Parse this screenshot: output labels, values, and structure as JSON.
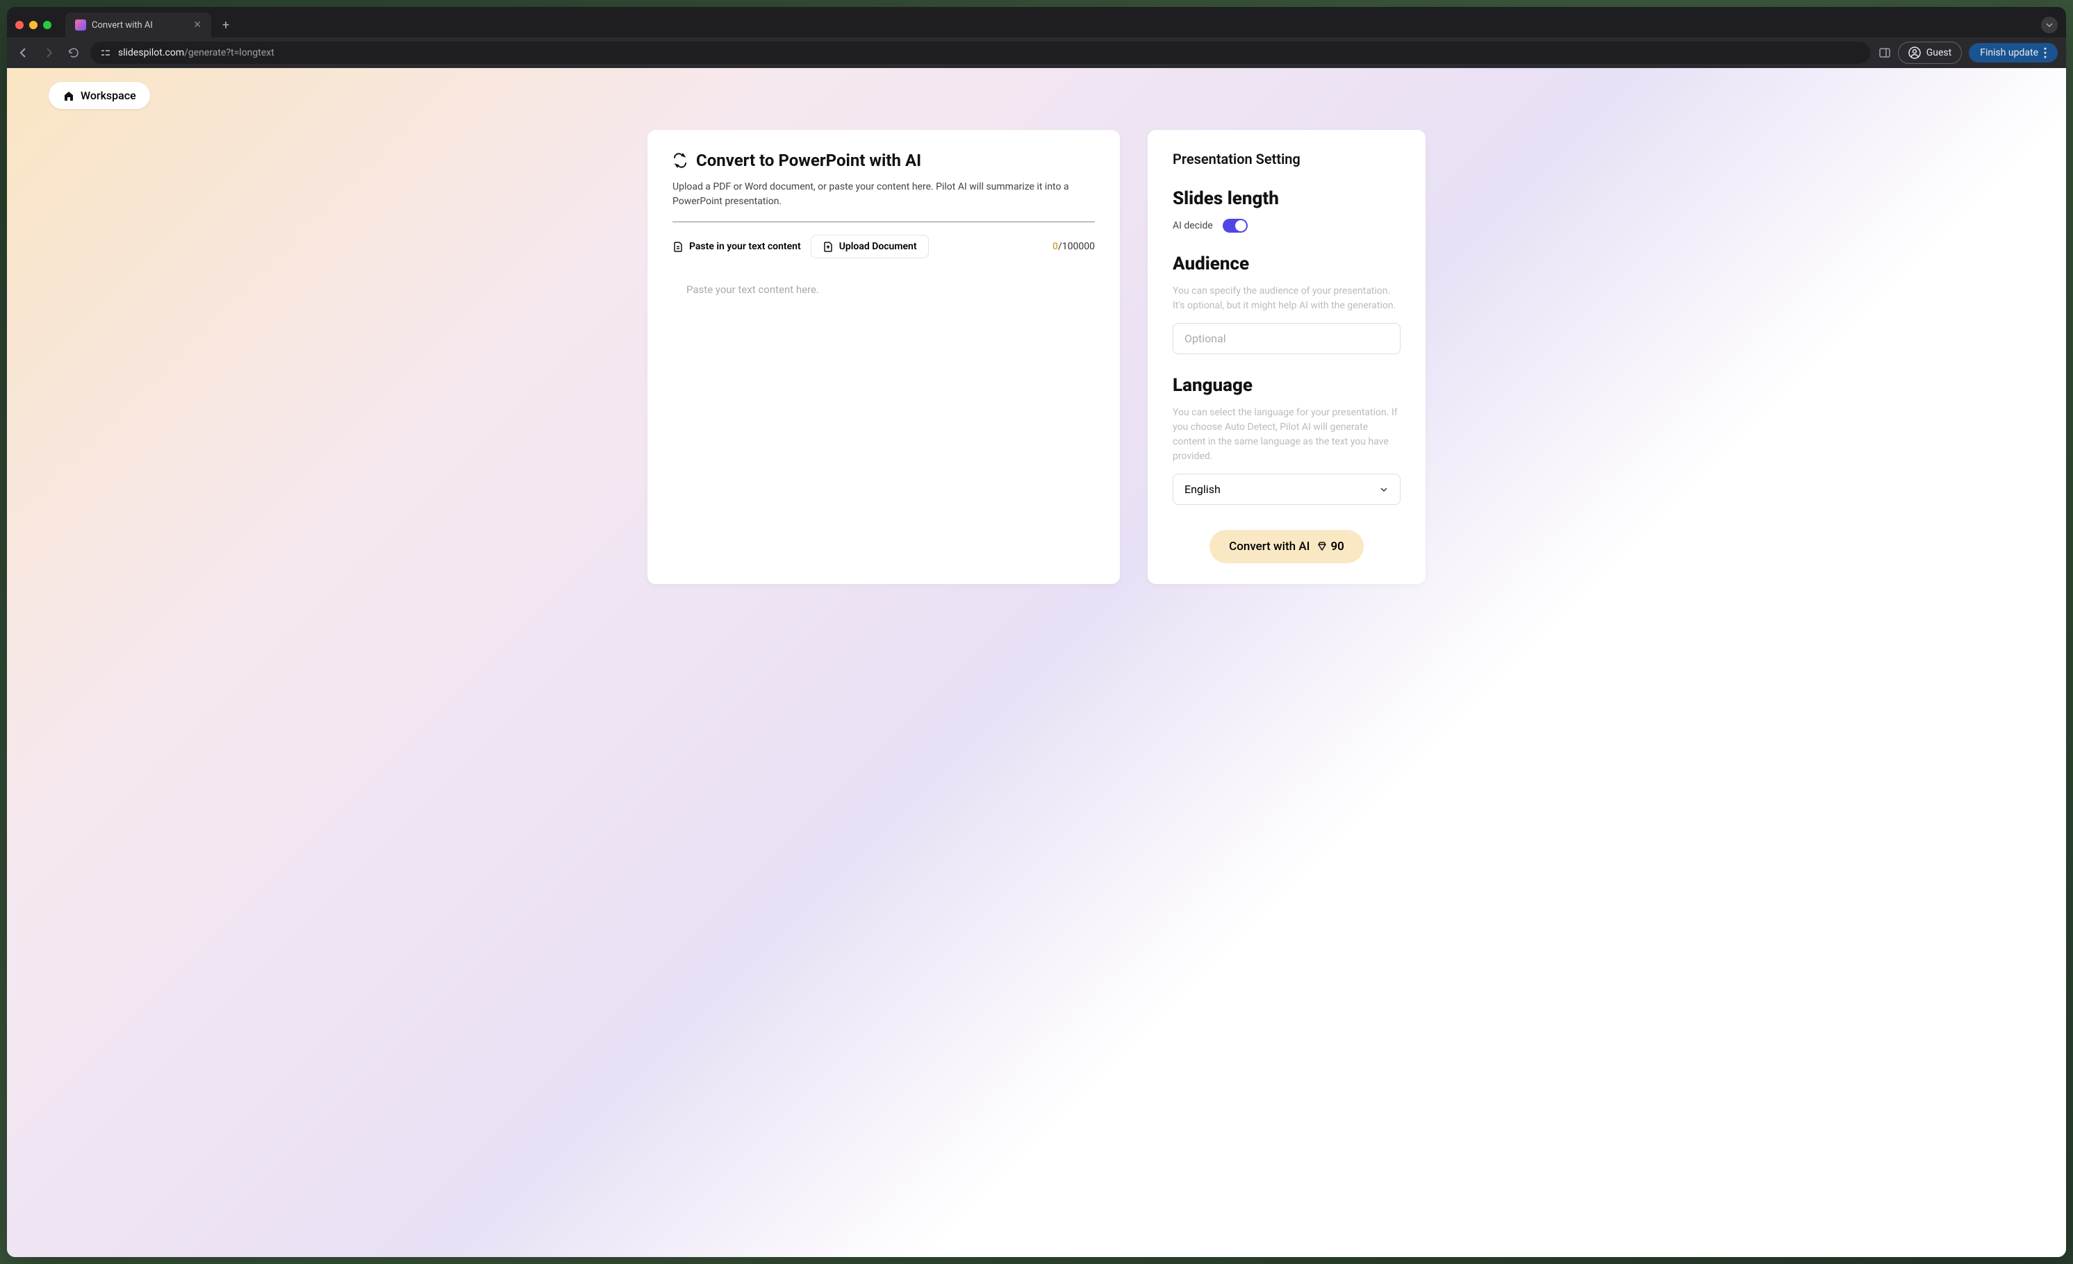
{
  "browser": {
    "tab_title": "Convert with AI",
    "url_domain": "slidespilot.com",
    "url_path": "/generate?t=longtext",
    "guest_label": "Guest",
    "finish_update_label": "Finish update"
  },
  "workspace_label": "Workspace",
  "page": {
    "title": "Convert to PowerPoint with AI",
    "subtitle": "Upload a PDF or Word document, or paste your content here. Pilot AI will summarize it into a PowerPoint presentation.",
    "paste_tab": "Paste in your text content",
    "upload_tab": "Upload Document",
    "char_current": "0",
    "char_max": "/100000",
    "textarea_placeholder": "Paste your text content here."
  },
  "settings": {
    "title": "Presentation Setting",
    "slides_length": {
      "heading": "Slides length",
      "toggle_label": "AI decide",
      "toggle_on": true
    },
    "audience": {
      "heading": "Audience",
      "desc": "You can specify the audience of your presentation. It's optional, but it might help AI with the generation.",
      "placeholder": "Optional"
    },
    "language": {
      "heading": "Language",
      "desc": "You can select the language for your presentation. If you choose Auto Detect, Pilot AI will generate content in the same language as the text you have provided.",
      "selected": "English"
    },
    "convert_label": "Convert with AI",
    "convert_cost": "90"
  }
}
